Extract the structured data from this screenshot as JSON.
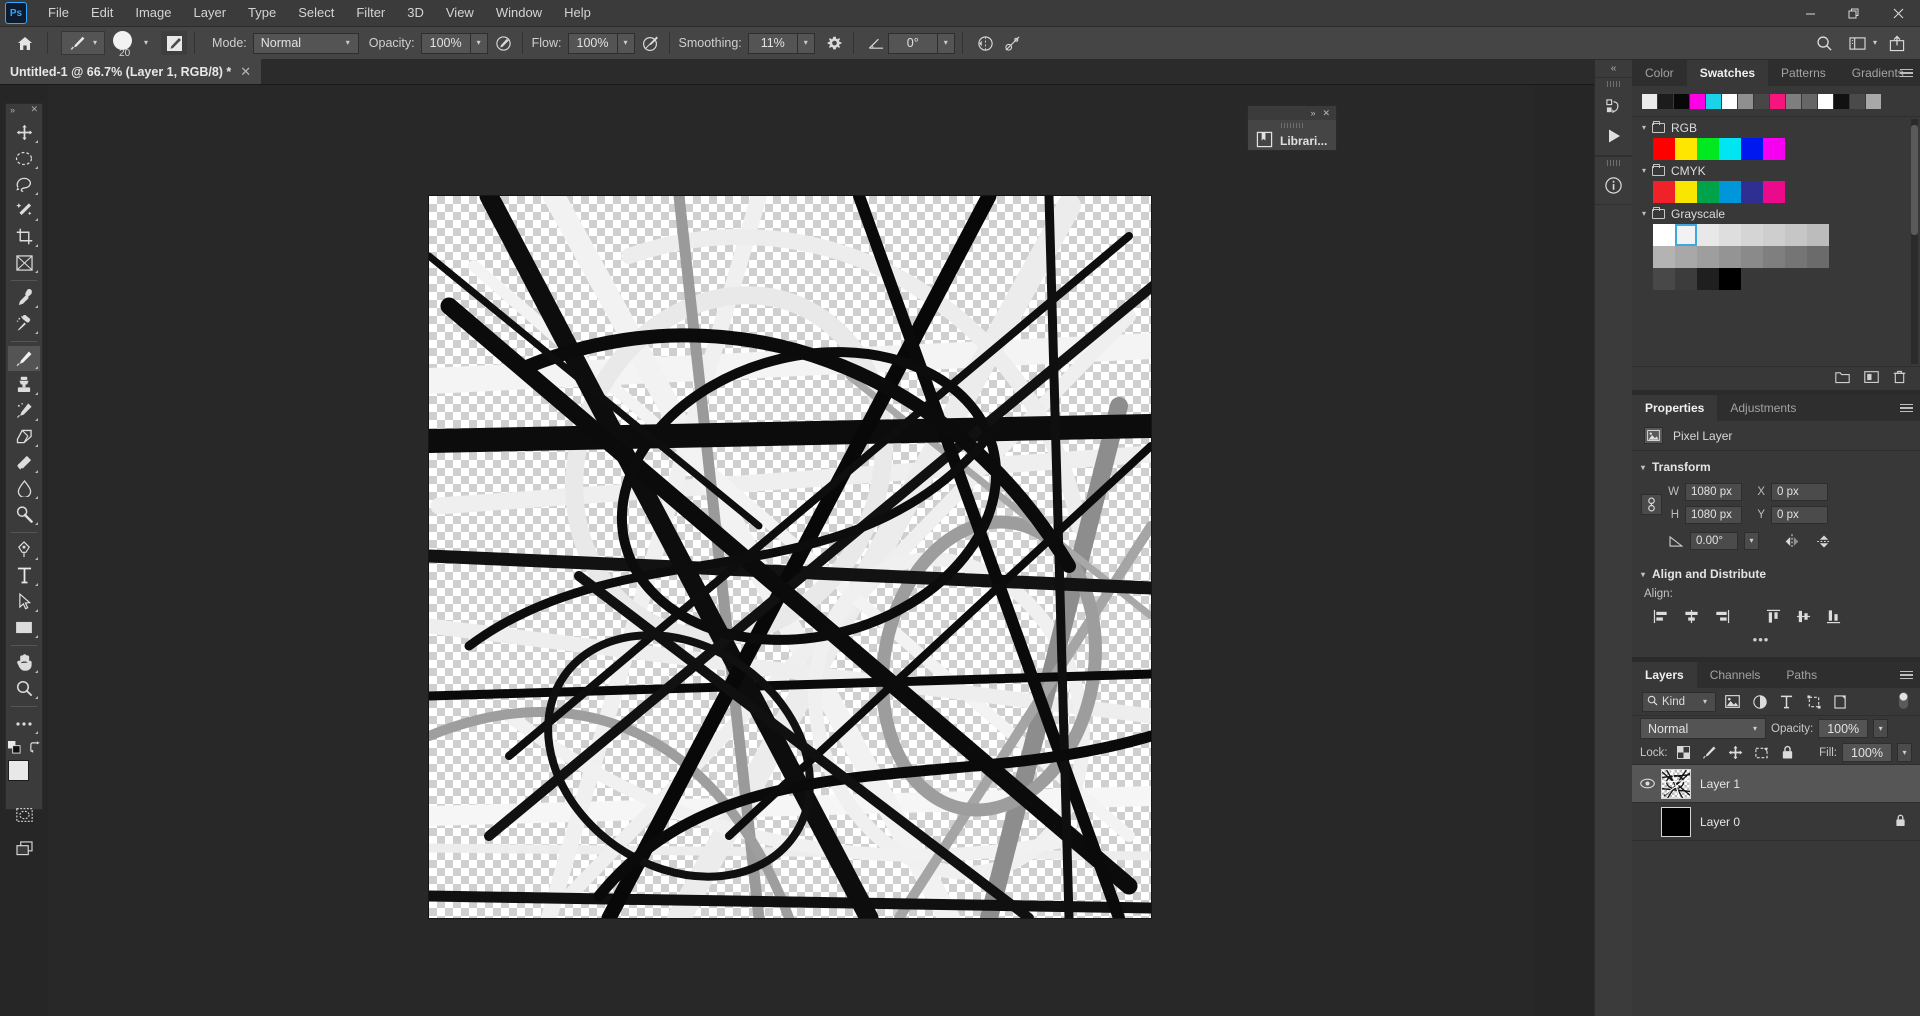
{
  "app": {
    "logo_text": "Ps",
    "window_controls": [
      {
        "name": "minimize-button",
        "glyph": "—"
      },
      {
        "name": "maximize-button",
        "glyph": "❐"
      },
      {
        "name": "close-button",
        "glyph": "✕"
      }
    ]
  },
  "menubar": {
    "items": [
      "File",
      "Edit",
      "Image",
      "Layer",
      "Type",
      "Select",
      "Filter",
      "3D",
      "View",
      "Window",
      "Help"
    ]
  },
  "options_bar": {
    "home_icon": "home-icon",
    "tool_icon": "brush-tool-icon",
    "brush_size": "20",
    "brush_preset_icon": "brush-settings-icon",
    "mode_label": "Mode:",
    "mode_value": "Normal",
    "opacity_label": "Opacity:",
    "opacity_value": "100%",
    "pressure_opacity_icon": "pressure-opacity-icon",
    "flow_label": "Flow:",
    "flow_value": "100%",
    "airbrush_icon": "airbrush-icon",
    "smoothing_label": "Smoothing:",
    "smoothing_value": "11%",
    "smoothing_gear_icon": "gear-icon",
    "angle_icon": "brush-angle-icon",
    "angle_value": "0°",
    "symmetry_icon": "symmetry-icon",
    "tablet_pressure_icon": "tablet-pressure-size-icon",
    "search_icon": "search-icon",
    "workspace_icon": "workspace-switcher-icon",
    "share_icon": "share-icon"
  },
  "document_tab": {
    "title": "Untitled-1 @ 66.7% (Layer 1, RGB/8) *",
    "close_glyph": "✕"
  },
  "toolbar": {
    "collapse_glyph": "»",
    "close_glyph": "✕",
    "tools": [
      {
        "name": "move-tool",
        "label": "Move Tool",
        "active": false
      },
      {
        "name": "elliptical-marquee-tool",
        "label": "Elliptical Marquee Tool",
        "active": false
      },
      {
        "name": "lasso-tool",
        "label": "Lasso Tool",
        "active": false
      },
      {
        "name": "magic-wand-tool",
        "label": "Object Selection Tool",
        "active": false
      },
      {
        "name": "crop-tool",
        "label": "Crop Tool",
        "active": false
      },
      {
        "name": "frame-tool",
        "label": "Frame Tool",
        "active": false
      },
      {
        "name": "eyedropper-tool",
        "label": "Eyedropper Tool",
        "active": false
      },
      {
        "name": "spot-healing-brush-tool",
        "label": "Spot Healing Brush Tool",
        "active": false
      },
      {
        "name": "brush-tool",
        "label": "Brush Tool",
        "active": true
      },
      {
        "name": "clone-stamp-tool",
        "label": "Clone Stamp Tool",
        "active": false
      },
      {
        "name": "history-brush-tool",
        "label": "History Brush Tool",
        "active": false
      },
      {
        "name": "eraser-tool",
        "label": "Eraser Tool",
        "active": false
      },
      {
        "name": "gradient-tool",
        "label": "Gradient Tool",
        "active": false
      },
      {
        "name": "blur-tool",
        "label": "Blur Tool",
        "active": false
      },
      {
        "name": "dodge-tool",
        "label": "Dodge Tool",
        "active": false
      },
      {
        "name": "pen-tool",
        "label": "Pen Tool",
        "active": false
      },
      {
        "name": "type-tool",
        "label": "Horizontal Type Tool",
        "active": false
      },
      {
        "name": "path-selection-tool",
        "label": "Path Selection Tool",
        "active": false
      },
      {
        "name": "rectangle-tool",
        "label": "Rectangle Tool",
        "active": false
      },
      {
        "name": "hand-tool",
        "label": "Hand Tool",
        "active": false
      },
      {
        "name": "zoom-tool",
        "label": "Zoom Tool",
        "active": false
      },
      {
        "name": "edit-toolbar-button",
        "label": "Edit Toolbar",
        "active": false
      }
    ],
    "foreground_color": "#e8e8e8",
    "background_color": "#ffffff",
    "default_colors_icon": "default-colors-icon",
    "swap_colors_icon": "swap-colors-icon",
    "quick_mask_icon": "quick-mask-icon",
    "screen_mode_icon": "screen-mode-icon"
  },
  "libraries_float": {
    "title": "Librari...",
    "expand_glyph": "»",
    "close_glyph": "✕",
    "icon": "libraries-icon"
  },
  "rail": {
    "collapse_glyph": "«",
    "icons": [
      {
        "name": "history-icon"
      },
      {
        "name": "actions-play-icon"
      },
      {
        "name": "info-icon"
      }
    ]
  },
  "swatches_panel": {
    "tabs": [
      {
        "label": "Color",
        "active": false
      },
      {
        "label": "Swatches",
        "active": true
      },
      {
        "label": "Patterns",
        "active": false
      },
      {
        "label": "Gradients",
        "active": false
      }
    ],
    "menu_icon": "panel-menu-icon",
    "recent_colors": [
      "#ececec",
      "#1c1c1c",
      "#080808",
      "#ff00e4",
      "#1ad3e8",
      "#ffffff",
      "#8f8f8f",
      "#474747",
      "#f5157c",
      "#7e7e7e",
      "#666666",
      "#ffffff",
      "#111111",
      "#4a4a4a",
      "#a8a8a8"
    ],
    "groups": [
      {
        "name": "RGB",
        "expanded": true,
        "rows": [
          [
            "#ff0000",
            "#ffe600",
            "#00e81f",
            "#00e5f2",
            "#0018f0",
            "#f500f0"
          ]
        ]
      },
      {
        "name": "CMYK",
        "expanded": true,
        "rows": [
          [
            "#ef2229",
            "#f8e500",
            "#00a24a",
            "#0096da",
            "#2e2f91",
            "#ec0a8c"
          ]
        ]
      },
      {
        "name": "Grayscale",
        "expanded": true,
        "rows": [
          [
            "#ffffff",
            "#f2f2f2",
            "#e8e8e8",
            "#dedede",
            "#d5d5d5",
            "#cecece",
            "#c6c6c6",
            "#bcbcbc"
          ],
          [
            "#b3b3b3",
            "#a8a8a8",
            "#9e9e9e",
            "#949494",
            "#8a8a8a",
            "#7f7f7f",
            "#757575",
            "#6b6b6b"
          ],
          [
            "#484848",
            "#3c3c3c",
            "#1f1f1f",
            "#000000"
          ]
        ],
        "selected_row": 0,
        "selected_col": 1
      }
    ],
    "footer_icons": [
      {
        "name": "new-group-icon"
      },
      {
        "name": "new-swatch-icon"
      },
      {
        "name": "delete-swatch-icon"
      }
    ]
  },
  "properties_panel": {
    "tabs": [
      {
        "label": "Properties",
        "active": true
      },
      {
        "label": "Adjustments",
        "active": false
      }
    ],
    "menu_icon": "panel-menu-icon",
    "layer_type": "Pixel Layer",
    "layer_type_icon": "pixel-layer-icon",
    "transform": {
      "section_label": "Transform",
      "link_icon": "link-dimensions-icon",
      "w_label": "W",
      "w_value": "1080 px",
      "h_label": "H",
      "h_value": "1080 px",
      "x_label": "X",
      "x_value": "0 px",
      "y_label": "Y",
      "y_value": "0 px",
      "angle_icon": "rotate-angle-icon",
      "angle_value": "0.00°",
      "flip_h_icon": "flip-horizontal-icon",
      "flip_v_icon": "flip-vertical-icon"
    },
    "align": {
      "section_label": "Align and Distribute",
      "align_label": "Align:",
      "icons": [
        {
          "name": "align-left-edges-icon"
        },
        {
          "name": "align-horizontal-centers-icon"
        },
        {
          "name": "align-right-edges-icon"
        },
        {
          "name": "align-top-edges-icon"
        },
        {
          "name": "align-vertical-centers-icon"
        },
        {
          "name": "align-bottom-edges-icon"
        }
      ],
      "more_glyph": "•••"
    }
  },
  "layers_panel": {
    "tabs": [
      {
        "label": "Layers",
        "active": true
      },
      {
        "label": "Channels",
        "active": false
      },
      {
        "label": "Paths",
        "active": false
      }
    ],
    "menu_icon": "panel-menu-icon",
    "filter_kind_label": "Kind",
    "filter_search_icon": "search-icon",
    "filter_icons": [
      {
        "name": "filter-pixel-icon"
      },
      {
        "name": "filter-adjustment-icon"
      },
      {
        "name": "filter-type-icon"
      },
      {
        "name": "filter-shape-icon"
      },
      {
        "name": "filter-smart-object-icon"
      }
    ],
    "filter_toggle_icon": "filter-toggle-switch",
    "blend_mode": "Normal",
    "opacity_label": "Opacity:",
    "opacity_value": "100%",
    "lock_label": "Lock:",
    "lock_icons": [
      {
        "name": "lock-transparent-pixels-icon"
      },
      {
        "name": "lock-image-pixels-icon"
      },
      {
        "name": "lock-position-icon"
      },
      {
        "name": "lock-artboard-nesting-icon"
      },
      {
        "name": "lock-all-icon"
      }
    ],
    "fill_label": "Fill:",
    "fill_value": "100%",
    "layers": [
      {
        "name": "Layer 1",
        "visible": true,
        "selected": true,
        "locked": false,
        "thumb": "checker"
      },
      {
        "name": "Layer 0",
        "visible": false,
        "selected": false,
        "locked": true,
        "thumb": "black"
      }
    ]
  },
  "canvas": {
    "zoom": "66.7%",
    "artwork_description": "abstract black white and gray brush strokes on transparent checkerboard"
  }
}
